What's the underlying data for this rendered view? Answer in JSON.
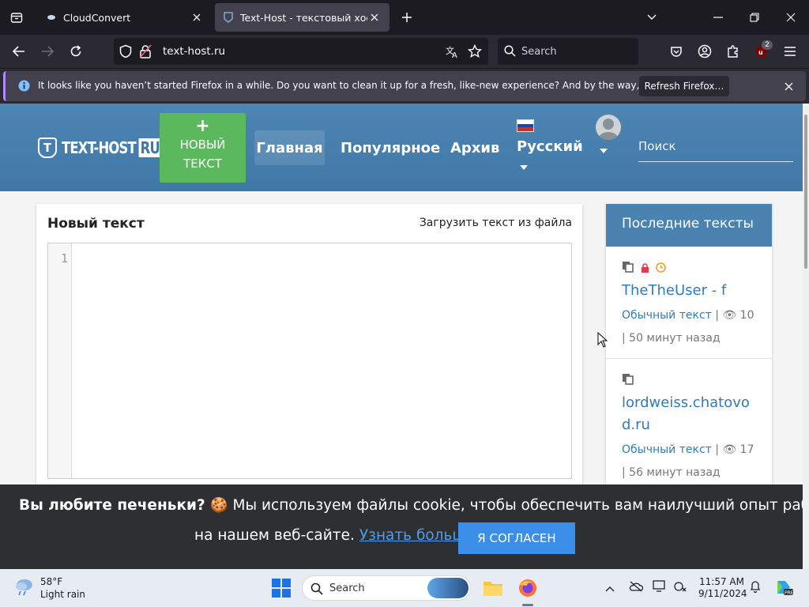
{
  "browser": {
    "tabs": [
      {
        "title": "CloudConvert"
      },
      {
        "title": "Text-Host - текстовый хостинг"
      }
    ],
    "url": "text-host.ru",
    "search_placeholder": "Search",
    "extension_badge": "2",
    "notification": {
      "message": "It looks like you haven’t started Firefox in a while. Do you want to clean it up for a fresh, like-new experience? And by the way, welcome back!",
      "button": "Refresh Firefox…"
    }
  },
  "site": {
    "logo_text": "TEXT-HOST",
    "logo_suffix": "RU",
    "logo_letter": "T",
    "new_text_plus": "+",
    "new_text_line1": "НОВЫЙ",
    "new_text_line2": "ТЕКСТ",
    "nav": {
      "home": "Главная",
      "popular": "Популярное",
      "archive": "Архив",
      "language": "Русский"
    },
    "search_placeholder": "Поиск",
    "editor": {
      "heading": "Новый текст",
      "upload": "Загрузить текст из файла",
      "line_number": "1"
    },
    "sidebar": {
      "title": "Последние тексты",
      "entries": [
        {
          "title": "TheTheUser - f",
          "type": "Обычный текст",
          "views": "10",
          "time": "50 минут назад"
        },
        {
          "title": "lordweiss.chatovod.ru",
          "type": "Обычный текст",
          "views": "17",
          "time": "56 минут назад"
        }
      ]
    },
    "cookie": {
      "bold": "Вы любите печеньки?",
      "emoji": "🍪",
      "line1_rest": "Мы используем файлы cookie, чтобы обеспечить вам наилучший опыт работы",
      "line2": "на нашем веб-сайте.",
      "learn_more": "Узнать больше",
      "agree": "Я СОГЛАСЕН"
    }
  },
  "taskbar": {
    "weather_temp": "58°F",
    "weather_desc": "Light rain",
    "search_placeholder": "Search",
    "time": "11:57 AM",
    "date": "9/11/2024"
  },
  "colors": {
    "header": "#4a82b0",
    "new_button": "#5cb85c",
    "link": "#2f7bbf",
    "agree": "#3b8fe8"
  }
}
